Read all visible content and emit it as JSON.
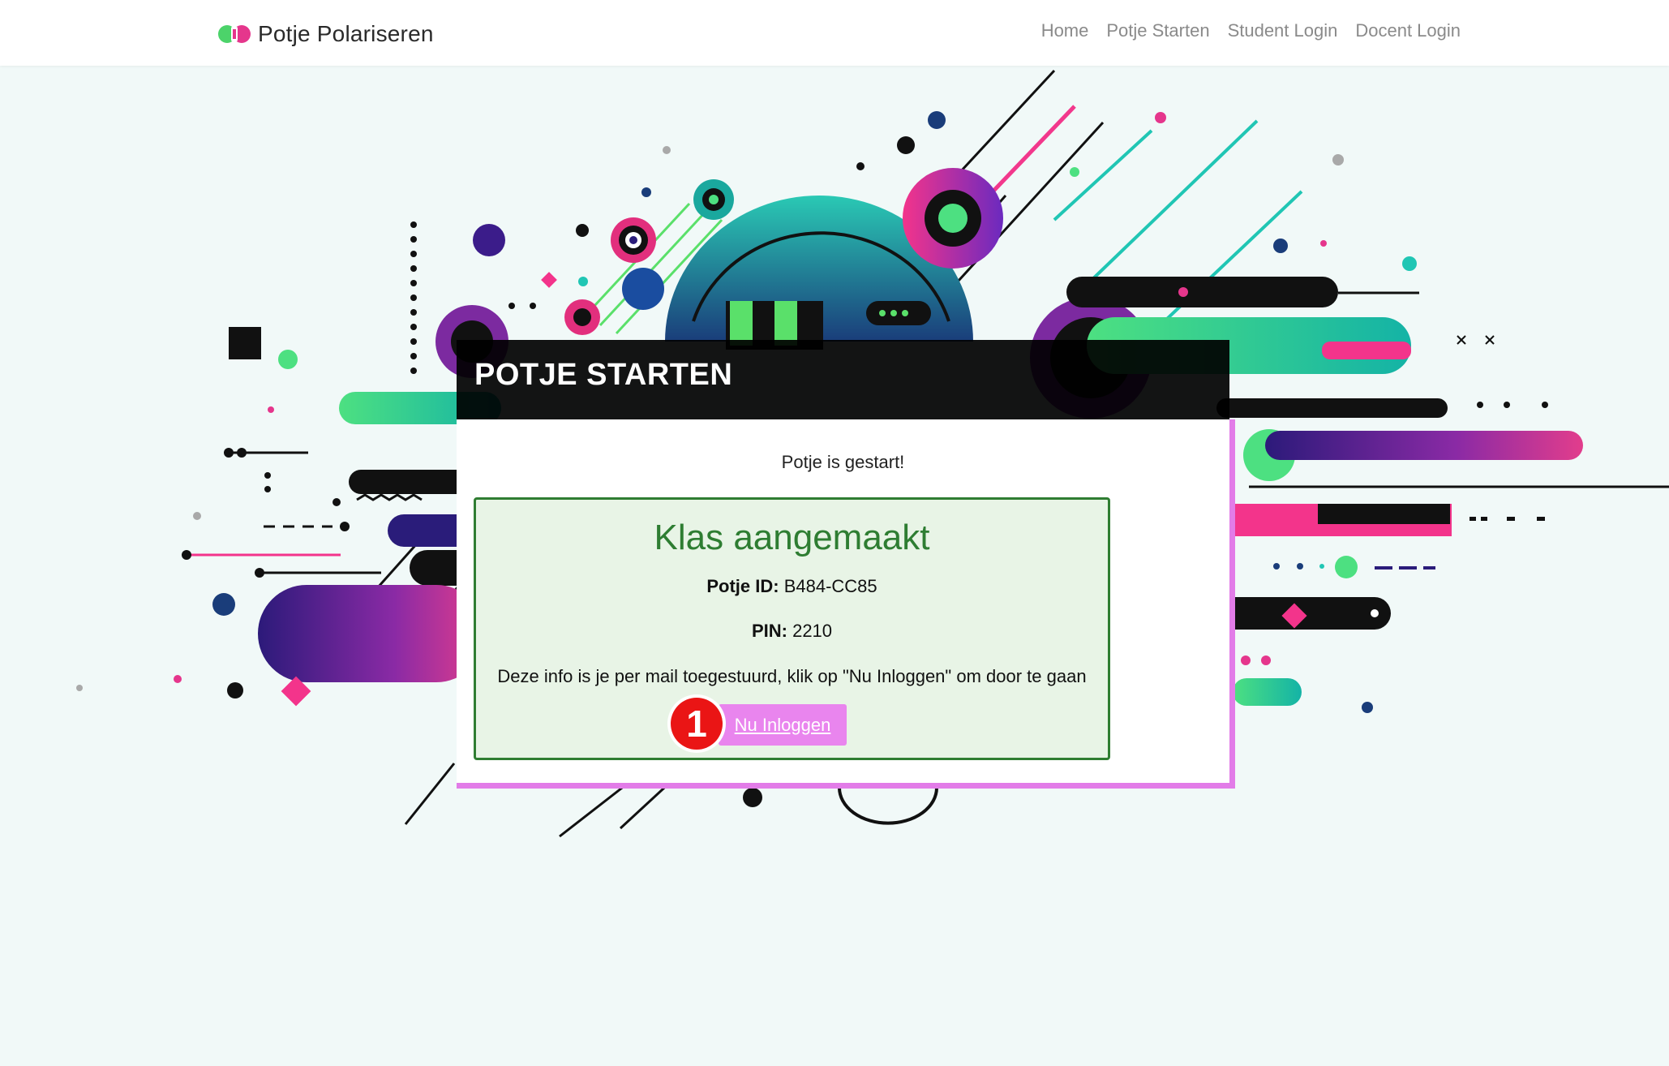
{
  "navbar": {
    "brand_name": "Potje Polariseren",
    "links": [
      "Home",
      "Potje Starten",
      "Student Login",
      "Docent Login"
    ]
  },
  "banner": {
    "title": "POTJE STARTEN"
  },
  "card": {
    "status": "Potje is gestart!",
    "success": {
      "title": "Klas aangemaakt",
      "potje_id_label": "Potje ID:",
      "potje_id_value": "B484-CC85",
      "pin_label": "PIN:",
      "pin_value": "2210",
      "message": "Deze info is je per mail toegestuurd, klik op \"Nu Inloggen\" om door te gaan",
      "login_button": "Nu Inloggen"
    }
  },
  "annotation": {
    "step_number": "1"
  },
  "colors": {
    "accent_pink": "#e985ee",
    "card_border": "#e27ce8",
    "success_green": "#2e7d32",
    "success_bg": "#e8f4e6",
    "step_red": "#ea1515"
  },
  "icons": {
    "brand": "brand-logo-icon"
  }
}
